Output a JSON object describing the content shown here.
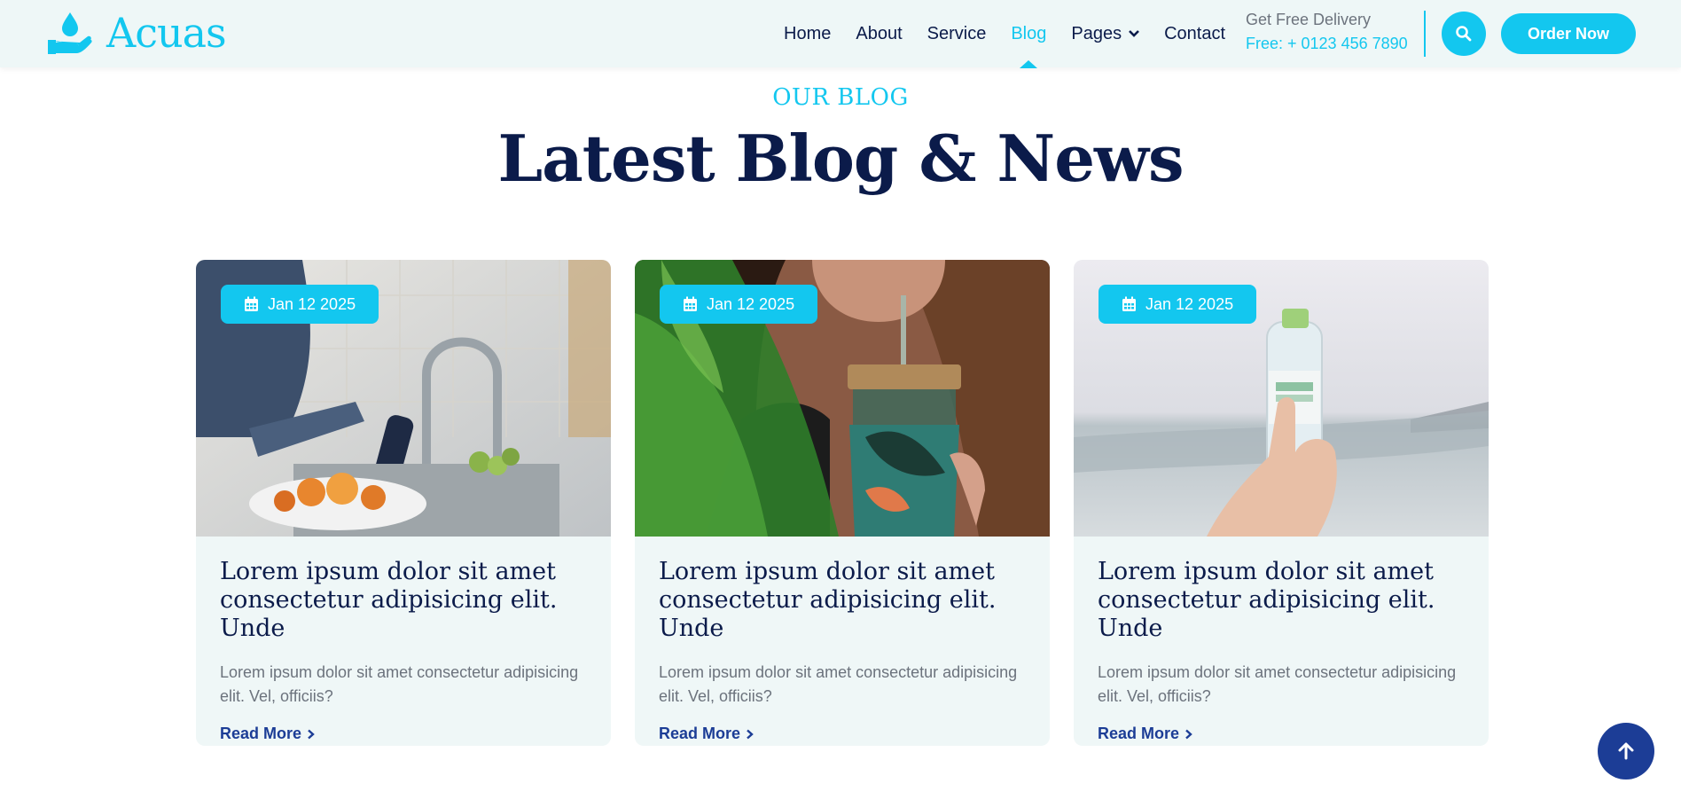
{
  "brand": {
    "name": "Acuas"
  },
  "nav": {
    "items": [
      {
        "label": "Home"
      },
      {
        "label": "About"
      },
      {
        "label": "Service"
      },
      {
        "label": "Blog"
      },
      {
        "label": "Pages"
      },
      {
        "label": "Contact"
      }
    ],
    "active": "Blog"
  },
  "header": {
    "delivery_label": "Get Free Delivery",
    "delivery_phone": "Free: + 0123 456 7890",
    "order_button": "Order Now"
  },
  "section": {
    "eyebrow": "OUR BLOG",
    "title": "Latest Blog & News"
  },
  "posts": [
    {
      "date": "Jan 12 2025",
      "title": "Lorem ipsum dolor sit amet consectetur adipisicing elit. Unde",
      "excerpt": "Lorem ipsum dolor sit amet consectetur adipisicing elit. Vel, officiis?",
      "link": "Read More",
      "image": "kitchen-faucet-bottle-photo"
    },
    {
      "date": "Jan 12 2025",
      "title": "Lorem ipsum dolor sit amet consectetur adipisicing elit. Unde",
      "excerpt": "Lorem ipsum dolor sit amet consectetur adipisicing elit. Vel, officiis?",
      "link": "Read More",
      "image": "woman-drinking-tumbler-photo"
    },
    {
      "date": "Jan 12 2025",
      "title": "Lorem ipsum dolor sit amet consectetur adipisicing elit. Unde",
      "excerpt": "Lorem ipsum dolor sit amet consectetur adipisicing elit. Vel, officiis?",
      "link": "Read More",
      "image": "hand-holding-water-bottle-beach-photo"
    }
  ],
  "colors": {
    "accent": "#13c7ef",
    "navy": "#0b1b4a",
    "link": "#1c3d96",
    "card_bg": "#eff7f7",
    "header_bg": "#eef7f7"
  },
  "icons": {
    "logo": "water-drop-hand-icon",
    "search": "search-icon",
    "calendar": "calendar-icon",
    "dropdown": "chevron-down-icon",
    "read_more": "chevron-right-icon",
    "scroll_top": "arrow-up-icon"
  }
}
